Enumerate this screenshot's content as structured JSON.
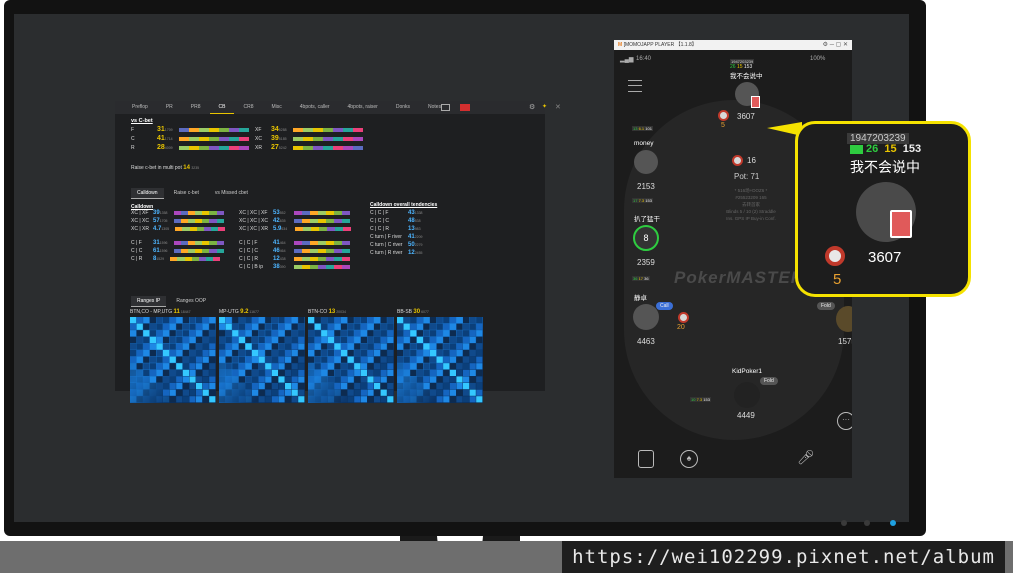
{
  "watermark": {
    "url": "https://wei102299.pixnet.net/album"
  },
  "stats_app": {
    "tabs": [
      "Preflop",
      "PR",
      "PR8",
      "CB",
      "CR8",
      "Misc",
      "4bpots, caller",
      "4bpots, raiser",
      "Donks",
      "Notes"
    ],
    "active_tab": "CB",
    "section_title": "vs C-bet",
    "vs_cbet_left": [
      {
        "label": "F",
        "value": "31",
        "sub": "1709"
      },
      {
        "label": "C",
        "value": "41",
        "sub": "1714"
      },
      {
        "label": "R",
        "value": "28",
        "sub": "4009"
      }
    ],
    "vs_cbet_right": [
      {
        "label": "XF",
        "value": "34",
        "sub": "5288"
      },
      {
        "label": "XC",
        "value": "39",
        "sub": "5185"
      },
      {
        "label": "XR",
        "value": "27",
        "sub": "5242"
      }
    ],
    "raise_multipot": {
      "label": "Raise c-bet in multi pot",
      "value": "14",
      "sub": "3235"
    },
    "subtabs": [
      "Calldown",
      "Raise c-bet",
      "vs Missed cbet"
    ],
    "active_subtab": "Calldown",
    "calldown_title": "Calldown",
    "calldown_rows_a": [
      {
        "label": "XC | XF",
        "value": "39",
        "sub": "1358"
      },
      {
        "label": "XC | XC",
        "value": "57",
        "sub": "1705"
      },
      {
        "label": "XC | XR",
        "value": "4.7",
        "sub": "1305"
      }
    ],
    "calldown_rows_b": [
      {
        "label": "XC | XC | XF",
        "value": "53",
        "sub": "552"
      },
      {
        "label": "XC | XC | XC",
        "value": "42",
        "sub": "635"
      },
      {
        "label": "XC | XC | XR",
        "value": "5.9",
        "sub": "634"
      }
    ],
    "calldown_rows_c": [
      {
        "label": "C | F",
        "value": "31",
        "sub": "1596"
      },
      {
        "label": "C | C",
        "value": "61",
        "sub": "1596"
      },
      {
        "label": "C | R",
        "value": "8",
        "sub": "1529"
      }
    ],
    "calldown_rows_d": [
      {
        "label": "C | C | F",
        "value": "41",
        "sub": "464"
      },
      {
        "label": "C | C | C",
        "value": "46",
        "sub": "464"
      },
      {
        "label": "C | C | R",
        "value": "12",
        "sub": "438"
      },
      {
        "label": "C | C | B ip",
        "value": "38",
        "sub": "390"
      }
    ],
    "overall_title": "Calldown overall tendencies",
    "overall_rows": [
      {
        "label": "C | C | F",
        "value": "43",
        "sub": "1338"
      },
      {
        "label": "C | C | C",
        "value": "48",
        "sub": "538"
      },
      {
        "label": "C | C | R",
        "value": "13",
        "sub": "983"
      },
      {
        "label": "C turn | F river",
        "value": "41",
        "sub": "2209"
      },
      {
        "label": "C turn | C river",
        "value": "50",
        "sub": "2279"
      },
      {
        "label": "C turn | R river",
        "value": "12",
        "sub": "2455"
      }
    ],
    "range_tabs": [
      "Ranges IP",
      "Ranges OOP"
    ],
    "active_range_tab": "Ranges IP",
    "ranges": [
      {
        "title": "BTN,CO - MP,UTG",
        "value": "11",
        "sub": "18447"
      },
      {
        "title": "MP-UTG",
        "value": "9.2",
        "sub": "11677"
      },
      {
        "title": "BTN-CO",
        "value": "13",
        "sub": "20034"
      },
      {
        "title": "BB-SB",
        "value": "30",
        "sub": "6077"
      }
    ]
  },
  "phone": {
    "titlebar": "[MOMOJAPP PLAYER 【1.1.8】",
    "status_time": "16:40",
    "battery": "100%",
    "top_player": {
      "id": "1947203239",
      "stats": [
        "26",
        "15",
        "153"
      ],
      "name": "我不会说中",
      "stack": "3607",
      "bet": "5"
    },
    "pot_chip_count": "16",
    "pot": "Pot: 71",
    "table_info": [
      "* 516场+DOZ6 *",
      "#25523209 165",
      "去转首家",
      "Blinds 5 / 10 (2) Straddle",
      "Ins. GPS IP Buy-in Conf."
    ],
    "left_player_1": {
      "stats": [
        "13",
        "6.1",
        "101"
      ],
      "name": "money",
      "stack": "2153"
    },
    "left_player_2": {
      "stats": [
        "17",
        "7.3",
        "153"
      ],
      "name": "扒了猛干",
      "stack": "2359",
      "timer": "8"
    },
    "left_player_3": {
      "stats": [
        "36",
        "17",
        "36"
      ],
      "name": "静卓",
      "stack": "4463",
      "action": "Call",
      "bet": "20"
    },
    "right_player": {
      "action": "Fold",
      "stack": "1575"
    },
    "bottom_player": {
      "name": "KidPoker1",
      "action": "Fold",
      "stats": [
        "10",
        "7.3",
        "153"
      ],
      "stack": "4449"
    },
    "logo": "PokerMASTER"
  },
  "callout": {
    "id": "1947203239",
    "stats": [
      "26",
      "15",
      "153"
    ],
    "name": "我不会说中",
    "stack": "3607",
    "bet": "5"
  },
  "colors": {
    "accent_yellow": "#f5e200",
    "stat_green": "#2ecc40",
    "stat_yellow": "#e8c400",
    "stat_blue": "#4db5ff"
  }
}
